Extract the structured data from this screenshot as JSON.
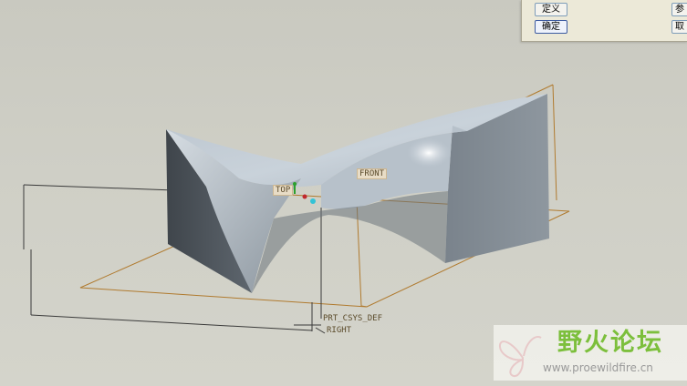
{
  "dialog": {
    "define_label": "定义",
    "confirm_label": "确定",
    "ref_label_partial": "参",
    "cancel_label_partial": "取"
  },
  "planes": {
    "top": "TOP",
    "front": "FRONT",
    "right": "RIGHT",
    "csys": "PRT_CSYS_DEF"
  },
  "watermark": {
    "title": "野火论坛",
    "url": "www.proewildfire.cn"
  },
  "colors": {
    "background": "#cfcfc6",
    "datum_plane": "#b07a2e",
    "sketch_line": "#3a3a3a",
    "surface_light": "#c4ced8",
    "surface_dark": "#4f565d",
    "watermark_green": "#7cbf3c"
  }
}
